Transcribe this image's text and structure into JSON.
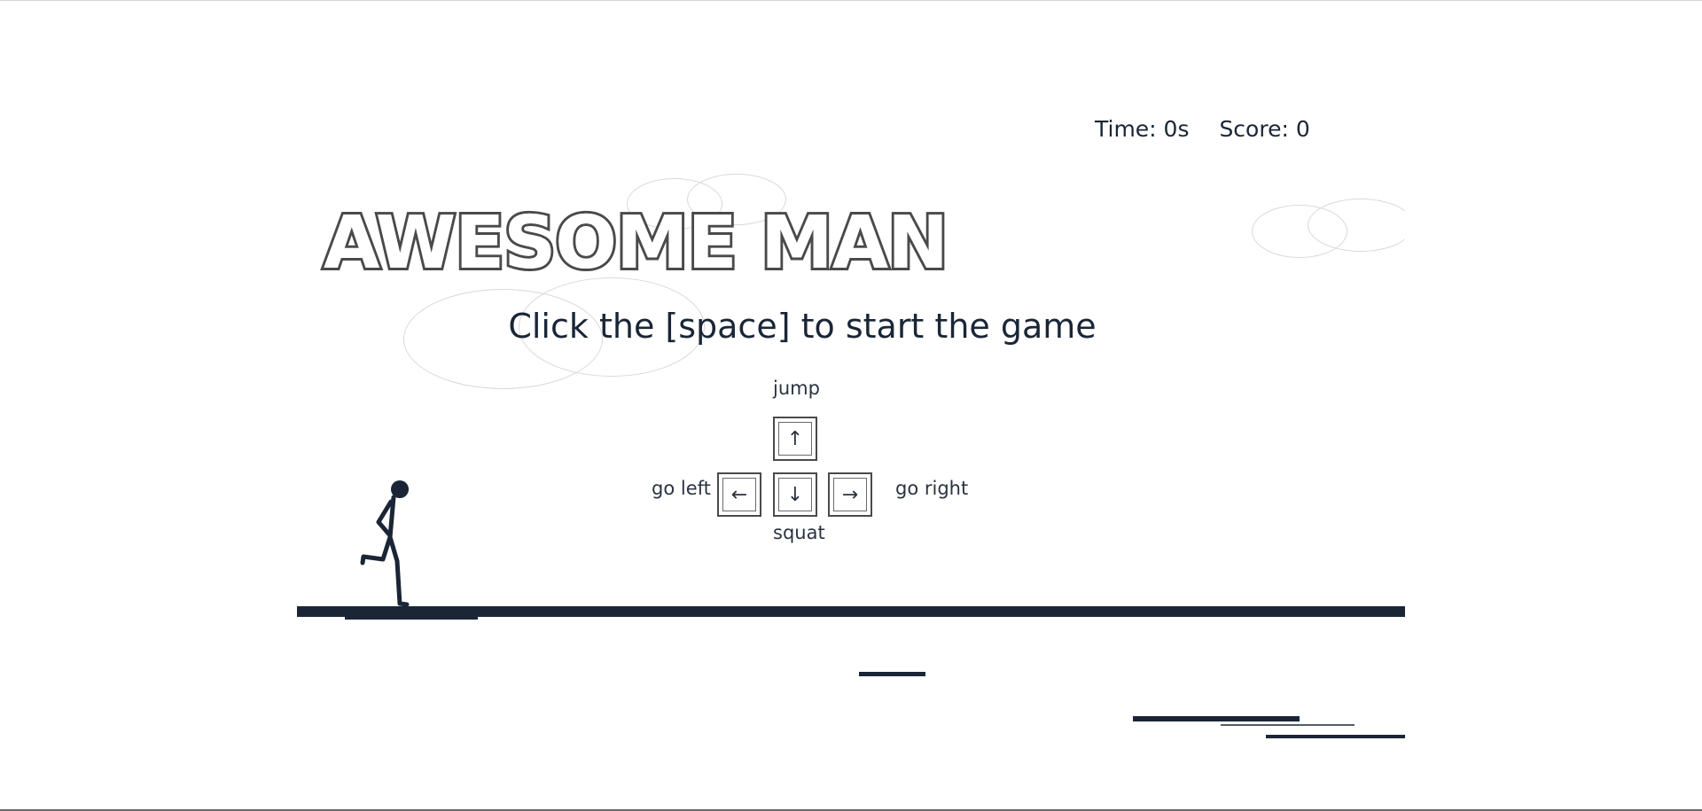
{
  "game": {
    "title": "AWESOME MAN",
    "start_message": "Click the [space] to start the game",
    "hud": {
      "time_label": "Time: 0s",
      "score_label": "Score: 0"
    },
    "controls": {
      "jump_label": "jump",
      "left_label": "go left",
      "right_label": "go right",
      "squat_label": "squat",
      "keys": {
        "up": "↑",
        "left": "←",
        "down": "↓",
        "right": "→"
      }
    },
    "colors": {
      "ground": "#1a2636",
      "text": "#1a2636",
      "cloud_outline": "#d9d9d9",
      "title_outline": "#4a4a4a"
    }
  }
}
